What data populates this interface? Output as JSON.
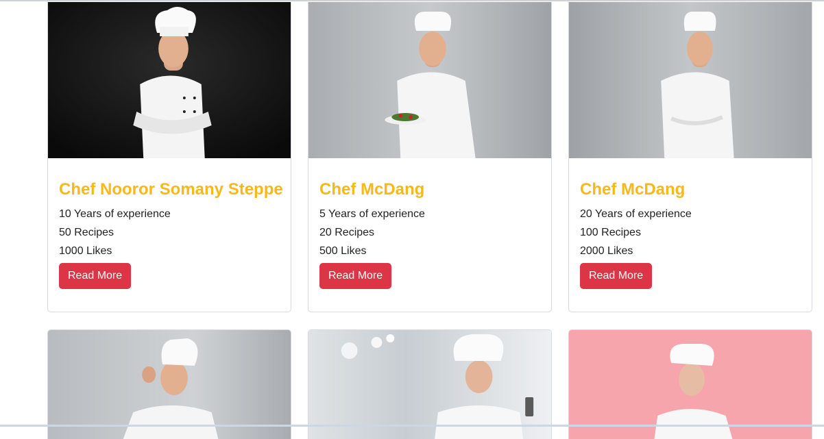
{
  "chefs": [
    {
      "name": "Chef Nooror Somany Steppe",
      "experience": "10 Years of experience",
      "recipes": "50 Recipes",
      "likes": "1000 Likes",
      "button": "Read More"
    },
    {
      "name": "Chef McDang",
      "experience": "5 Years of experience",
      "recipes": "20 Recipes",
      "likes": "500 Likes",
      "button": "Read More"
    },
    {
      "name": "Chef McDang",
      "experience": "20 Years of experience",
      "recipes": "100 Recipes",
      "likes": "2000 Likes",
      "button": "Read More"
    }
  ],
  "colors": {
    "name": "#f5b91a",
    "button": "#dc3545",
    "photo_bg_dark": "#0f0f0f",
    "photo_bg_grey": "#b8bcc0",
    "photo_bg_pink": "#f6a5ad"
  }
}
